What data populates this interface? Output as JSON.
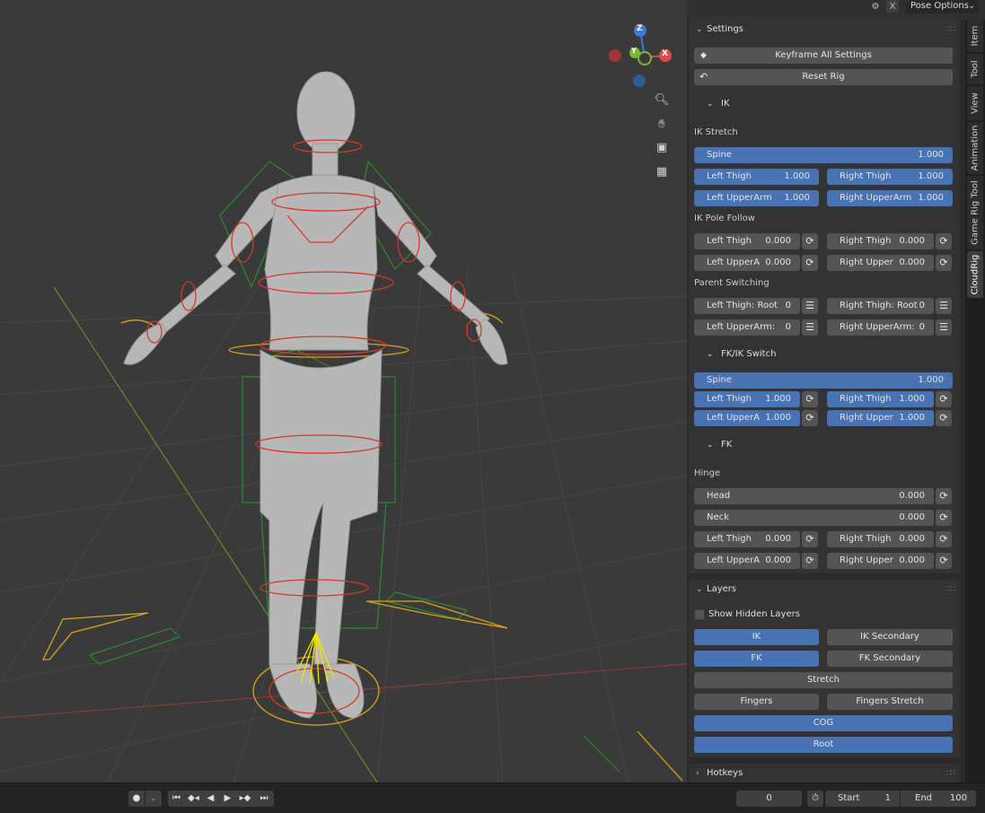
{
  "header": {
    "mode_label": "Pose Options",
    "x_label": "X"
  },
  "navigation": {
    "axes": {
      "z": "Z",
      "y": "Y",
      "x": "X"
    }
  },
  "sidebar": {
    "tabs": [
      "Item",
      "Tool",
      "View",
      "Animation",
      "Game Rig Tool",
      "CloudRig"
    ],
    "active_tab": "CloudRig",
    "settings": {
      "title": "Settings",
      "keyframe_all": "Keyframe All Settings",
      "reset_rig": "Reset Rig",
      "ik": {
        "title": "IK",
        "ik_stretch_label": "IK Stretch",
        "spine": {
          "name": "Spine",
          "value": "1.000"
        },
        "left_thigh": {
          "name": "Left Thigh",
          "value": "1.000"
        },
        "right_thigh": {
          "name": "Right Thigh",
          "value": "1.000"
        },
        "left_upperarm": {
          "name": "Left UpperArm",
          "value": "1.000"
        },
        "right_upperarm": {
          "name": "Right UpperArm",
          "value": "1.000"
        },
        "pole_follow_label": "IK Pole Follow",
        "pf_left_thigh": {
          "name": "Left Thigh",
          "value": "0.000"
        },
        "pf_right_thigh": {
          "name": "Right Thigh",
          "value": "0.000"
        },
        "pf_left_upper": {
          "name": "Left UpperA",
          "value": "0.000"
        },
        "pf_right_upper": {
          "name": "Right Upper",
          "value": "0.000"
        },
        "parent_switching_label": "Parent Switching",
        "ps_left_thigh": {
          "name": "Left Thigh: Root",
          "value": "0"
        },
        "ps_right_thigh": {
          "name": "Right Thigh: Root",
          "value": "0"
        },
        "ps_left_upperarm": {
          "name": "Left UpperArm:",
          "value": "0"
        },
        "ps_right_upperarm": {
          "name": "Right UpperArm:",
          "value": "0"
        }
      },
      "fkik": {
        "title": "FK/IK Switch",
        "spine": {
          "name": "Spine",
          "value": "1.000"
        },
        "left_thigh": {
          "name": "Left Thigh",
          "value": "1.000"
        },
        "right_thigh": {
          "name": "Right Thigh",
          "value": "1.000"
        },
        "left_upper": {
          "name": "Left UpperA",
          "value": "1.000"
        },
        "right_upper": {
          "name": "Right Upper",
          "value": "1.000"
        }
      },
      "fk": {
        "title": "FK",
        "hinge_label": "Hinge",
        "head": {
          "name": "Head",
          "value": "0.000"
        },
        "neck": {
          "name": "Neck",
          "value": "0.000"
        },
        "left_thigh": {
          "name": "Left Thigh",
          "value": "0.000"
        },
        "right_thigh": {
          "name": "Right Thigh",
          "value": "0.000"
        },
        "left_upper": {
          "name": "Left UpperA",
          "value": "0.000"
        },
        "right_upper": {
          "name": "Right Upper",
          "value": "0.000"
        }
      }
    },
    "layers": {
      "title": "Layers",
      "show_hidden": "Show Hidden Layers",
      "ik": "IK",
      "ik_secondary": "IK Secondary",
      "fk": "FK",
      "fk_secondary": "FK Secondary",
      "stretch": "Stretch",
      "fingers": "Fingers",
      "fingers_stretch": "Fingers Stretch",
      "cog": "COG",
      "root": "Root"
    },
    "hotkeys": {
      "title": "Hotkeys"
    }
  },
  "timeline": {
    "current_frame": "0",
    "start_label": "Start",
    "start_value": "1",
    "end_label": "End",
    "end_value": "100"
  },
  "colors": {
    "accent_blue": "#4772b3",
    "panel_bg": "#333333",
    "widget_bg": "#545454"
  }
}
